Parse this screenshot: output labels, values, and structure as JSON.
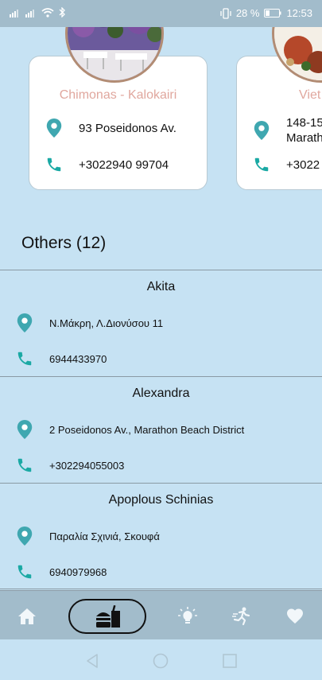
{
  "status_bar": {
    "battery_percent": "28 %",
    "time": "12:53"
  },
  "featured": [
    {
      "name": "Chimonas - Kalokairi",
      "address": "93 Poseidonos Av.",
      "phone": "+3022940 99704"
    },
    {
      "name": "Viet",
      "address_line1": "148-15",
      "address_line2": "Marath",
      "phone": "+3022"
    }
  ],
  "others": {
    "title": "Others (12)",
    "items": [
      {
        "name": "Akita",
        "address": "Ν.Μάκρη, Λ.Διονύσου 11",
        "phone": "6944433970"
      },
      {
        "name": "Alexandra",
        "address": "2 Poseidonos Av., Marathon Beach District",
        "phone": "+302294055003"
      },
      {
        "name": "Apoplous Schinias",
        "address": "Παραλία Σχινιά, Σκουφά",
        "phone": "6940979968"
      }
    ]
  },
  "bottom_nav": {
    "items": [
      {
        "icon": "home-icon"
      },
      {
        "icon": "food-drink-icon",
        "active": true
      },
      {
        "icon": "sights-icon"
      },
      {
        "icon": "activities-icon"
      },
      {
        "icon": "favorites-icon"
      }
    ]
  },
  "system_nav": {
    "buttons": [
      "back-icon",
      "home-circle-icon",
      "recents-icon"
    ]
  },
  "colors": {
    "background": "#c6e2f3",
    "bar": "#a2bccb",
    "card_title": "#e0a79e",
    "pin": "#3fa7b0",
    "phone": "#1aa9a4"
  }
}
